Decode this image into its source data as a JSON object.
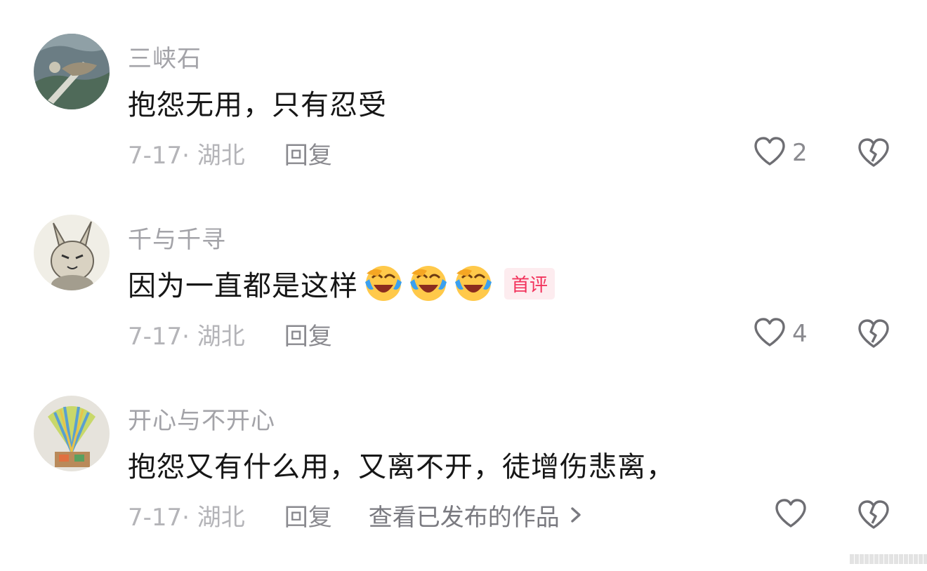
{
  "comments": [
    {
      "username": "三峡石",
      "text": "抱怨无用，只有忍受",
      "date": "7-17· 湖北",
      "reply": "回复",
      "likes": "2",
      "emojis": [],
      "badge": "",
      "extra": ""
    },
    {
      "username": "千与千寻",
      "text": "因为一直都是这样",
      "date": "7-17· 湖北",
      "reply": "回复",
      "likes": "4",
      "emojis": [
        "laughing-crying-emoji",
        "laughing-crying-emoji",
        "laughing-crying-emoji"
      ],
      "badge": "首评",
      "extra": ""
    },
    {
      "username": "开心与不开心",
      "text": "抱怨又有什么用，又离不开，徒增伤悲离，",
      "date": "7-17· 湖北",
      "reply": "回复",
      "likes": "",
      "emojis": [],
      "badge": "",
      "extra": "查看已发布的作品"
    }
  ],
  "icons": {
    "like": "heart-outline-icon",
    "dislike": "broken-heart-icon",
    "more": "chevron-right-icon"
  },
  "colors": {
    "username": "#a3a3a8",
    "text": "#161616",
    "badge_text": "#f2335c",
    "badge_bg": "#fdecef",
    "icon": "#6e6e73"
  }
}
